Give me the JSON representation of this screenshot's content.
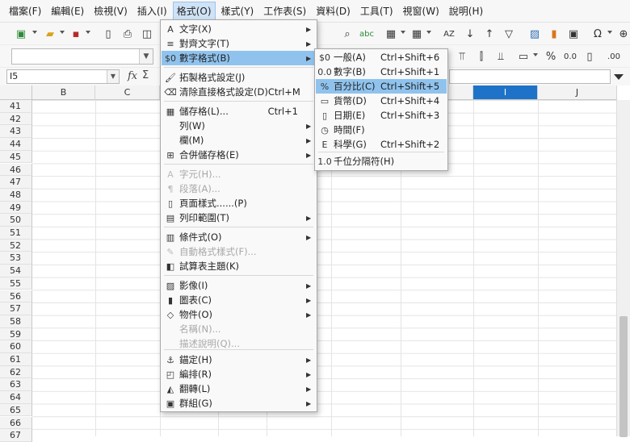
{
  "menubar": {
    "items": [
      "檔案(F)",
      "編輯(E)",
      "檢視(V)",
      "插入(I)",
      "格式(O)",
      "樣式(Y)",
      "工作表(S)",
      "資料(D)",
      "工具(T)",
      "視窗(W)",
      "說明(H)"
    ],
    "active": "格式(O)"
  },
  "toolbar": {
    "abc": "abc",
    "zero_decimal": "0.0",
    "percent": "%",
    "decimal_more": ".00"
  },
  "formula_bar": {
    "name_box": "I5",
    "fx": "fx",
    "sigma": "Σ"
  },
  "columns": {
    "labels": [
      "B",
      "C",
      "I",
      "J"
    ],
    "selected": "I"
  },
  "rows": [
    "41",
    "42",
    "43",
    "44",
    "45",
    "46",
    "47",
    "48",
    "49",
    "50",
    "51",
    "52",
    "53",
    "54",
    "55",
    "56",
    "57",
    "58",
    "59",
    "60",
    "61",
    "62",
    "63",
    "64",
    "65",
    "66",
    "67"
  ],
  "format_menu": {
    "items": [
      {
        "icon": "A",
        "label": "文字(X)",
        "shortcut": "",
        "submenu": true,
        "disabled": false
      },
      {
        "icon": "≡",
        "label": "對齊文字(T)",
        "shortcut": "",
        "submenu": true,
        "disabled": false
      },
      {
        "icon": "$0",
        "label": "數字格式(B)",
        "shortcut": "",
        "submenu": true,
        "disabled": false,
        "highlighted": true
      },
      {
        "icon": "🖌",
        "label": "拓製格式設定(J)",
        "shortcut": "",
        "submenu": false,
        "disabled": false
      },
      {
        "icon": "⌫",
        "label": "清除直接格式設定(D)",
        "shortcut": "Ctrl+M",
        "submenu": false,
        "disabled": false
      },
      {
        "icon": "▦",
        "label": "儲存格(L)...",
        "shortcut": "Ctrl+1",
        "submenu": false,
        "disabled": false
      },
      {
        "icon": "",
        "label": "列(W)",
        "shortcut": "",
        "submenu": true,
        "disabled": false
      },
      {
        "icon": "",
        "label": "欄(M)",
        "shortcut": "",
        "submenu": true,
        "disabled": false
      },
      {
        "icon": "⊞",
        "label": "合併儲存格(E)",
        "shortcut": "",
        "submenu": true,
        "disabled": false
      },
      {
        "icon": "A",
        "label": "字元(H)...",
        "shortcut": "",
        "submenu": false,
        "disabled": true
      },
      {
        "icon": "¶",
        "label": "段落(A)...",
        "shortcut": "",
        "submenu": false,
        "disabled": true
      },
      {
        "icon": "▯",
        "label": "頁面樣式......(P)",
        "shortcut": "",
        "submenu": false,
        "disabled": false
      },
      {
        "icon": "▤",
        "label": "列印範圍(T)",
        "shortcut": "",
        "submenu": true,
        "disabled": false
      },
      {
        "icon": "▥",
        "label": "條件式(O)",
        "shortcut": "",
        "submenu": true,
        "disabled": false
      },
      {
        "icon": "✎",
        "label": "自動格式樣式(F)...",
        "shortcut": "",
        "submenu": false,
        "disabled": true
      },
      {
        "icon": "◧",
        "label": "試算表主題(K)",
        "shortcut": "",
        "submenu": false,
        "disabled": false
      },
      {
        "icon": "▨",
        "label": "影像(I)",
        "shortcut": "",
        "submenu": true,
        "disabled": false
      },
      {
        "icon": "▮",
        "label": "圖表(C)",
        "shortcut": "",
        "submenu": true,
        "disabled": false
      },
      {
        "icon": "◇",
        "label": "物件(O)",
        "shortcut": "",
        "submenu": true,
        "disabled": false
      },
      {
        "icon": "",
        "label": "名稱(N)...",
        "shortcut": "",
        "submenu": false,
        "disabled": true
      },
      {
        "icon": "",
        "label": "描述說明(Q)...",
        "shortcut": "",
        "submenu": false,
        "disabled": true
      },
      {
        "icon": "⚓",
        "label": "錨定(H)",
        "shortcut": "",
        "submenu": true,
        "disabled": false
      },
      {
        "icon": "◰",
        "label": "編排(R)",
        "shortcut": "",
        "submenu": true,
        "disabled": false
      },
      {
        "icon": "◭",
        "label": "翻轉(L)",
        "shortcut": "",
        "submenu": true,
        "disabled": false
      },
      {
        "icon": "▣",
        "label": "群組(G)",
        "shortcut": "",
        "submenu": true,
        "disabled": false
      }
    ]
  },
  "number_menu": {
    "items": [
      {
        "icon": "$0",
        "label": "一般(A)",
        "shortcut": "Ctrl+Shift+6"
      },
      {
        "icon": "0.0",
        "label": "數字(B)",
        "shortcut": "Ctrl+Shift+1"
      },
      {
        "icon": "%",
        "label": "百分比(C)",
        "shortcut": "Ctrl+Shift+5",
        "highlighted": true
      },
      {
        "icon": "▭",
        "label": "貨幣(D)",
        "shortcut": "Ctrl+Shift+4"
      },
      {
        "icon": "▯",
        "label": "日期(E)",
        "shortcut": "Ctrl+Shift+3"
      },
      {
        "icon": "◷",
        "label": "時間(F)",
        "shortcut": ""
      },
      {
        "icon": "E",
        "label": "科學(G)",
        "shortcut": "Ctrl+Shift+2"
      },
      {
        "icon": "1.0",
        "label": "千位分隔符(H)",
        "shortcut": ""
      }
    ]
  }
}
